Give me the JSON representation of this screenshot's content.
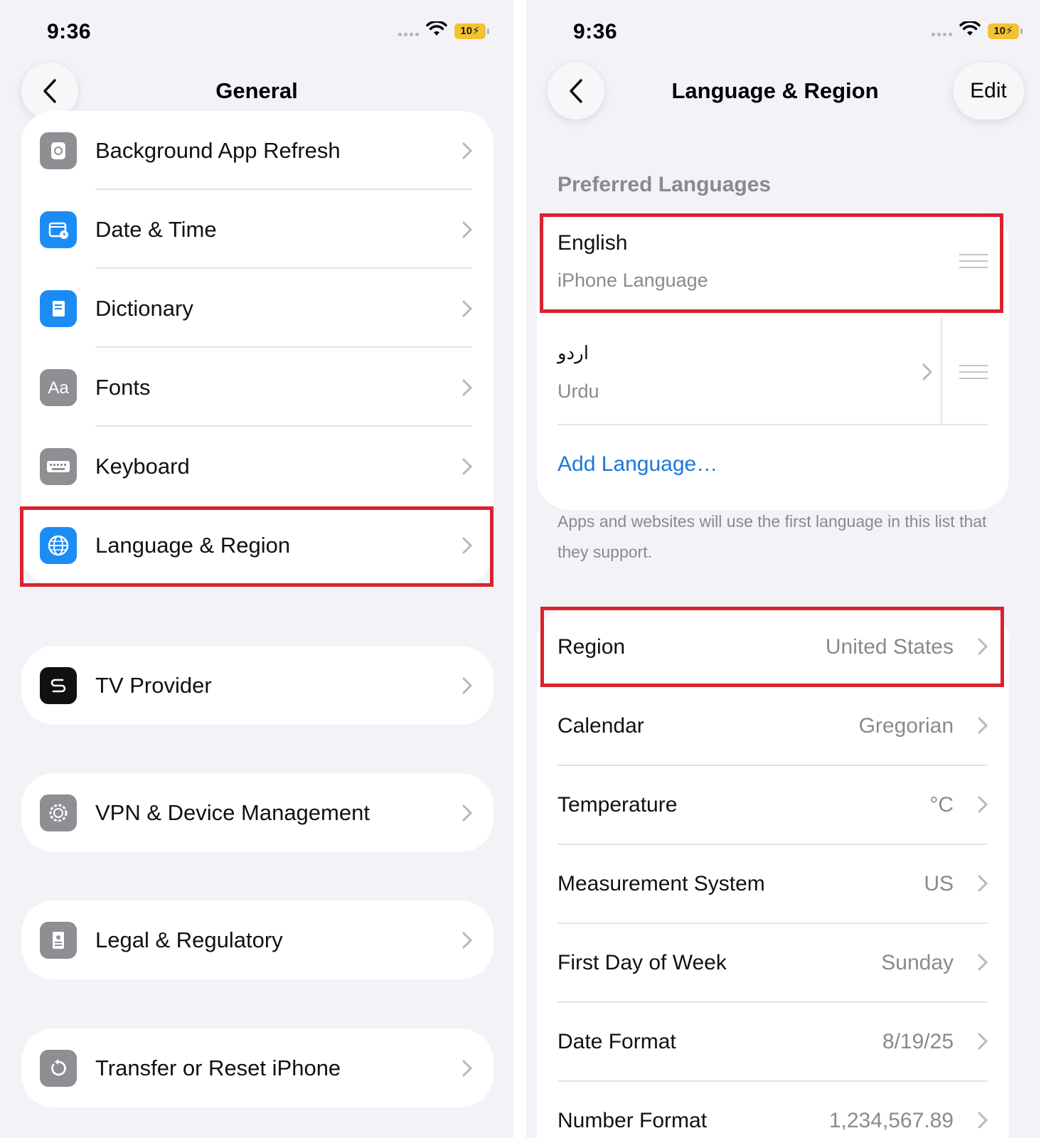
{
  "status_bar": {
    "time": "9:36",
    "battery": "10"
  },
  "left_screen": {
    "nav": {
      "title": "General"
    },
    "rows_group1": [
      {
        "label": "Background App Refresh",
        "icon": "background-refresh-icon"
      },
      {
        "label": "Date & Time",
        "icon": "calendar-clock-icon"
      },
      {
        "label": "Dictionary",
        "icon": "dictionary-book-icon"
      },
      {
        "label": "Fonts",
        "icon": "fonts-aa-icon"
      },
      {
        "label": "Keyboard",
        "icon": "keyboard-icon"
      },
      {
        "label": "Language & Region",
        "icon": "globe-icon"
      }
    ],
    "tv_provider": {
      "label": "TV Provider",
      "icon": "tv-provider-icon"
    },
    "vpn": {
      "label": "VPN & Device Management",
      "icon": "gear-icon"
    },
    "legal": {
      "label": "Legal & Regulatory",
      "icon": "legal-document-icon"
    },
    "transfer": {
      "label": "Transfer or Reset iPhone",
      "icon": "reset-arrow-icon"
    }
  },
  "right_screen": {
    "nav": {
      "title": "Language & Region",
      "edit_label": "Edit"
    },
    "preferred_header": "Preferred Languages",
    "languages": [
      {
        "name": "English",
        "subtitle": "iPhone Language"
      },
      {
        "name": "اردو",
        "subtitle": "Urdu"
      }
    ],
    "add_language": "Add Language…",
    "footnote": "Apps and websites will use the first language in this list that they support.",
    "settings": [
      {
        "label": "Region",
        "value": "United States"
      },
      {
        "label": "Calendar",
        "value": "Gregorian"
      },
      {
        "label": "Temperature",
        "value": "°C"
      },
      {
        "label": "Measurement System",
        "value": "US"
      },
      {
        "label": "First Day of Week",
        "value": "Sunday"
      },
      {
        "label": "Date Format",
        "value": "8/19/25"
      },
      {
        "label": "Number Format",
        "value": "1,234,567.89"
      }
    ]
  },
  "colors": {
    "highlight": "#d9232e",
    "link": "#1b78d8",
    "background": "#f2f2f7"
  }
}
